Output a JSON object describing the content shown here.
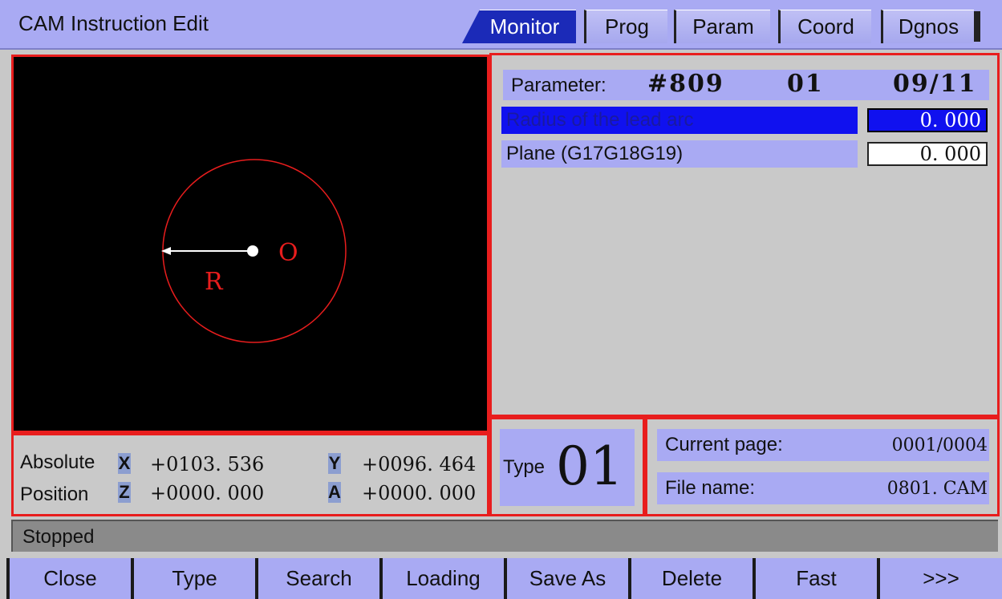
{
  "header": {
    "title": "CAM Instruction  Edit",
    "tabs": [
      {
        "label": "Monitor",
        "active": true
      },
      {
        "label": "Prog",
        "active": false
      },
      {
        "label": "Param",
        "active": false
      },
      {
        "label": "Coord",
        "active": false
      },
      {
        "label": "Dgnos",
        "active": false
      }
    ]
  },
  "graphic": {
    "center_label": "O",
    "radius_label": "R"
  },
  "parameter": {
    "label": "Parameter:",
    "number": "#809",
    "group": "01",
    "page": "09/11",
    "rows": [
      {
        "label": "Radius of the lead arc",
        "value": "0. 000",
        "selected": true
      },
      {
        "label": "Plane (G17G18G19)",
        "value": "0. 000",
        "selected": false
      }
    ]
  },
  "position": {
    "label_line1": "Absolute",
    "label_line2": "Position",
    "axes": [
      {
        "axis": "X",
        "value": "+0103. 536"
      },
      {
        "axis": "Y",
        "value": "+0096. 464"
      },
      {
        "axis": "Z",
        "value": "+0000. 000"
      },
      {
        "axis": "A",
        "value": "+0000. 000"
      }
    ]
  },
  "type_box": {
    "label": "Type",
    "value": "01"
  },
  "info": {
    "current_page_label": "Current page:",
    "current_page_value": "0001/0004",
    "file_name_label": "File name:",
    "file_name_value": "0801. CAM"
  },
  "status": {
    "text": "Stopped"
  },
  "softkeys": [
    "Close",
    "Type",
    "Search",
    "Loading",
    "Save As",
    "Delete",
    "Fast",
    ">>>"
  ],
  "colors": {
    "accent_blue": "#a9aaf3",
    "selected_blue": "#1011ef",
    "frame_red": "#e81d1d",
    "graphic_red": "#e81d1d"
  }
}
